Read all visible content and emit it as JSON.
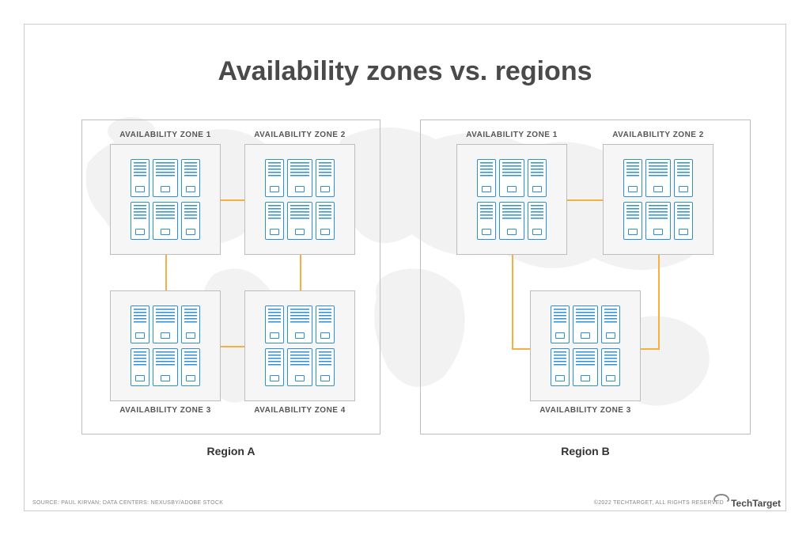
{
  "title": "Availability zones vs. regions",
  "regionA": {
    "label": "Region A",
    "zones": {
      "az1": "AVAILABILITY ZONE 1",
      "az2": "AVAILABILITY ZONE 2",
      "az3": "AVAILABILITY ZONE 3",
      "az4": "AVAILABILITY ZONE 4"
    }
  },
  "regionB": {
    "label": "Region B",
    "zones": {
      "az1": "AVAILABILITY ZONE 1",
      "az2": "AVAILABILITY ZONE 2",
      "az3": "AVAILABILITY ZONE 3"
    }
  },
  "footer": {
    "source": "SOURCE: PAUL KIRVAN; DATA CENTERS: NEXUSBY/ADOBE STOCK",
    "copyright": "©2022 TECHTARGET, ALL RIGHTS RESERVED",
    "brand": "TechTarget"
  },
  "colors": {
    "title": "#4a4a4a",
    "border": "#bdbdbd",
    "server": "#2e8fd9",
    "connection": "#f5b041",
    "mapFill": "#d0d0d0"
  }
}
